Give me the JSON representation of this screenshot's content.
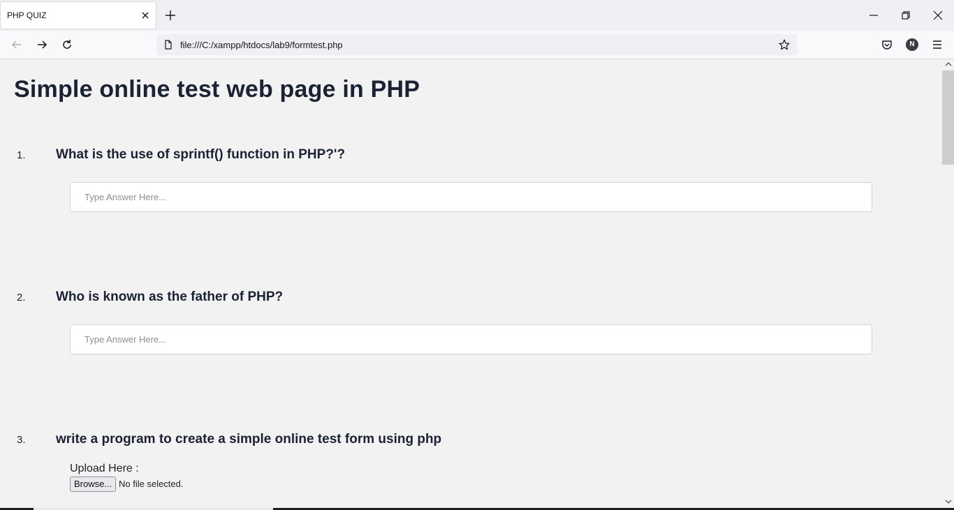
{
  "browser": {
    "tab_title": "PHP QUIZ",
    "url": "file:///C:/xampp/htdocs/lab9/formtest.php",
    "profile_initial": "N"
  },
  "page": {
    "title": "Simple online test web page in PHP",
    "questions": [
      {
        "number": "1.",
        "text": "What is the use of sprintf() function in PHP?'?",
        "placeholder": "Type Answer Here..."
      },
      {
        "number": "2.",
        "text": "Who is known as the father of PHP?",
        "placeholder": "Type Answer Here..."
      },
      {
        "number": "3.",
        "text": "write a program to create a simple online test form using php"
      }
    ],
    "upload": {
      "label": "Upload Here :",
      "button_label": "Browse...",
      "status": "No file selected."
    }
  },
  "colors": {
    "page_bg": "#f2f2f2",
    "heading_text": "#1a2233",
    "input_border": "#cfd4da"
  }
}
